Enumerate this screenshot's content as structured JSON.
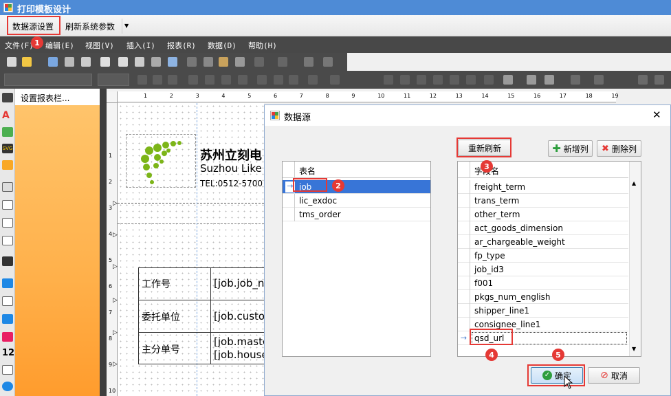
{
  "window": {
    "title": "打印模板设计"
  },
  "toolbar1": {
    "datasource_btn": "数据源设置",
    "refresh_btn": "刷新系统参数"
  },
  "menu": [
    {
      "label": "文件(F)"
    },
    {
      "label": "编辑(E)"
    },
    {
      "label": "视图(V)"
    },
    {
      "label": "插入(I)"
    },
    {
      "label": "报表(R)"
    },
    {
      "label": "数据(D)"
    },
    {
      "label": "帮助(H)"
    }
  ],
  "left_panel": {
    "title": "设置报表栏..."
  },
  "ruler": {
    "h": [
      "1",
      "2",
      "3",
      "4",
      "5",
      "6",
      "7",
      "8",
      "9",
      "10",
      "11",
      "12",
      "13",
      "14",
      "15",
      "16",
      "17",
      "18",
      "19"
    ],
    "v": [
      "1",
      "2",
      "3",
      "4",
      "5",
      "6",
      "7",
      "8",
      "9",
      "10"
    ]
  },
  "template": {
    "company_cn": "苏州立刻电",
    "company_en": "Suzhou Like",
    "tel": "TEL:0512-5700",
    "rows": [
      {
        "label": "工作号",
        "value": "[job.job_n"
      },
      {
        "label": "委托单位",
        "value": "[job.custo"
      },
      {
        "label": "主分单号",
        "value": "[job.maste",
        "value2": "[job.house"
      }
    ]
  },
  "dialog": {
    "title": "数据源",
    "close": "✕",
    "refresh_btn": "重新刷新",
    "add_col_btn": "新增列",
    "del_col_btn": "删除列",
    "table_header": "表名",
    "tables": [
      "job",
      "lic_exdoc",
      "tms_order"
    ],
    "field_header": "字段名",
    "fields": [
      "freight_term",
      "trans_term",
      "other_term",
      "act_goods_dimension",
      "ar_chargeable_weight",
      "fp_type",
      "job_id3",
      "f001",
      "pkgs_num_english",
      "shipper_line1",
      "consignee_line1",
      "qsd_url"
    ],
    "ok_btn": "确定",
    "cancel_btn": "取消"
  },
  "badges": [
    "1",
    "2",
    "3",
    "4",
    "5"
  ],
  "colors": {
    "titlebar": "#4e8bd6",
    "selection": "#3875d7",
    "annotation": "#e53935",
    "panel": "#ffb04a"
  }
}
